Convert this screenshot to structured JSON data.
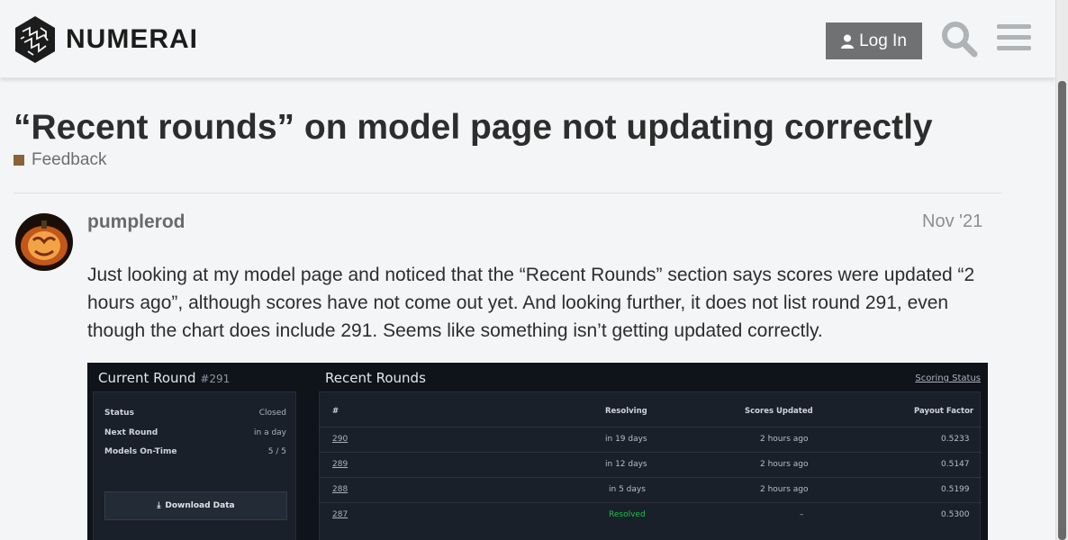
{
  "header": {
    "logo_text": "NUMERAI",
    "login_label": "Log In"
  },
  "topic": {
    "title": "“Recent rounds” on model page not updating correctly",
    "category": "Feedback",
    "category_color": "#8c6238"
  },
  "post": {
    "username": "pumplerod",
    "date": "Nov '21",
    "body": "Just looking at my model page and noticed that the “Recent Rounds” section says scores were updated “2 hours ago”, although scores have not come out yet. And looking further, it does not list round 291, even though the chart does include 291. Seems like something isn’t getting updated correctly."
  },
  "screenshot": {
    "current_round": {
      "title": "Current Round",
      "round_number": "#291",
      "status_label": "Status",
      "status_value": "Closed",
      "next_round_label": "Next Round",
      "next_round_value": "in a day",
      "models_label": "Models On-Time",
      "models_value": "5 / 5",
      "download_label": "Download Data"
    },
    "recent_rounds": {
      "title": "Recent Rounds",
      "link": "Scoring Status",
      "headers": [
        "#",
        "Resolving",
        "Scores Updated",
        "Payout Factor"
      ],
      "rows": [
        {
          "round": "290",
          "resolving": "in 19 days",
          "updated": "2 hours ago",
          "payout": "0.5233"
        },
        {
          "round": "289",
          "resolving": "in 12 days",
          "updated": "2 hours ago",
          "payout": "0.5147"
        },
        {
          "round": "288",
          "resolving": "in 5 days",
          "updated": "2 hours ago",
          "payout": "0.5199"
        },
        {
          "round": "287",
          "resolving": "Resolved",
          "updated": "–",
          "payout": "0.5300"
        }
      ]
    }
  }
}
